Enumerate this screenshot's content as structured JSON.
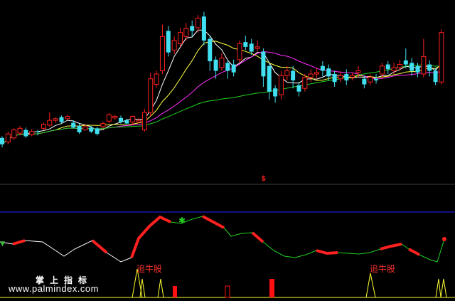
{
  "chart_data": {
    "type": "candlestick",
    "candles": [
      {
        "o": 178,
        "c": 170,
        "h": 180,
        "l": 166
      },
      {
        "o": 173,
        "c": 183,
        "h": 186,
        "l": 170
      },
      {
        "o": 178,
        "c": 188,
        "h": 190,
        "l": 176
      },
      {
        "o": 184,
        "c": 190,
        "h": 193,
        "l": 181
      },
      {
        "o": 188,
        "c": 180,
        "h": 191,
        "l": 178
      },
      {
        "o": 182,
        "c": 186,
        "h": 189,
        "l": 180
      },
      {
        "o": 186,
        "c": 185,
        "h": 188,
        "l": 181
      },
      {
        "o": 190,
        "c": 195,
        "h": 197,
        "l": 188
      },
      {
        "o": 194,
        "c": 200,
        "h": 210,
        "l": 192
      },
      {
        "o": 200,
        "c": 202,
        "h": 204,
        "l": 197
      },
      {
        "o": 204,
        "c": 198,
        "h": 206,
        "l": 196
      },
      {
        "o": 202,
        "c": 205,
        "h": 207,
        "l": 200
      },
      {
        "o": 197,
        "c": 191,
        "h": 200,
        "l": 190
      },
      {
        "o": 193,
        "c": 185,
        "h": 196,
        "l": 183
      },
      {
        "o": 188,
        "c": 192,
        "h": 194,
        "l": 187
      },
      {
        "o": 191,
        "c": 186,
        "h": 193,
        "l": 184
      },
      {
        "o": 190,
        "c": 183,
        "h": 192,
        "l": 181
      },
      {
        "o": 192,
        "c": 196,
        "h": 198,
        "l": 190
      },
      {
        "o": 199,
        "c": 207,
        "h": 209,
        "l": 197
      },
      {
        "o": 203,
        "c": 205,
        "h": 207,
        "l": 201
      },
      {
        "o": 203,
        "c": 198,
        "h": 206,
        "l": 196
      },
      {
        "o": 200,
        "c": 196,
        "h": 202,
        "l": 195
      },
      {
        "o": 198,
        "c": 205,
        "h": 206,
        "l": 194
      },
      {
        "o": 198,
        "c": 200,
        "h": 203,
        "l": 196
      },
      {
        "o": 188,
        "c": 210,
        "h": 214,
        "l": 186
      },
      {
        "o": 210,
        "c": 252,
        "h": 260,
        "l": 205
      },
      {
        "o": 245,
        "c": 258,
        "h": 262,
        "l": 241
      },
      {
        "o": 262,
        "c": 305,
        "h": 320,
        "l": 258
      },
      {
        "o": 312,
        "c": 285,
        "h": 318,
        "l": 280
      },
      {
        "o": 288,
        "c": 300,
        "h": 305,
        "l": 283
      },
      {
        "o": 296,
        "c": 310,
        "h": 316,
        "l": 292
      },
      {
        "o": 305,
        "c": 315,
        "h": 322,
        "l": 300
      },
      {
        "o": 318,
        "c": 312,
        "h": 325,
        "l": 305
      },
      {
        "o": 316,
        "c": 328,
        "h": 332,
        "l": 310
      },
      {
        "o": 330,
        "c": 300,
        "h": 336,
        "l": 294
      },
      {
        "o": 302,
        "c": 274,
        "h": 306,
        "l": 262
      },
      {
        "o": 276,
        "c": 262,
        "h": 280,
        "l": 252
      },
      {
        "o": 266,
        "c": 278,
        "h": 284,
        "l": 262
      },
      {
        "o": 272,
        "c": 262,
        "h": 276,
        "l": 252
      },
      {
        "o": 270,
        "c": 260,
        "h": 276,
        "l": 255
      },
      {
        "o": 276,
        "c": 296,
        "h": 300,
        "l": 272
      },
      {
        "o": 298,
        "c": 292,
        "h": 306,
        "l": 288
      },
      {
        "o": 296,
        "c": 286,
        "h": 302,
        "l": 282
      },
      {
        "o": 290,
        "c": 292,
        "h": 300,
        "l": 286
      },
      {
        "o": 286,
        "c": 255,
        "h": 290,
        "l": 242
      },
      {
        "o": 268,
        "c": 236,
        "h": 272,
        "l": 226
      },
      {
        "o": 240,
        "c": 230,
        "h": 244,
        "l": 222
      },
      {
        "o": 232,
        "c": 256,
        "h": 262,
        "l": 226
      },
      {
        "o": 256,
        "c": 262,
        "h": 268,
        "l": 250
      },
      {
        "o": 262,
        "c": 250,
        "h": 268,
        "l": 240
      },
      {
        "o": 244,
        "c": 236,
        "h": 248,
        "l": 230
      },
      {
        "o": 240,
        "c": 254,
        "h": 258,
        "l": 236
      },
      {
        "o": 254,
        "c": 258,
        "h": 264,
        "l": 248
      },
      {
        "o": 258,
        "c": 260,
        "h": 266,
        "l": 252
      },
      {
        "o": 268,
        "c": 262,
        "h": 274,
        "l": 255
      },
      {
        "o": 265,
        "c": 255,
        "h": 270,
        "l": 250
      },
      {
        "o": 258,
        "c": 248,
        "h": 262,
        "l": 242
      },
      {
        "o": 252,
        "c": 256,
        "h": 262,
        "l": 248
      },
      {
        "o": 258,
        "c": 250,
        "h": 264,
        "l": 244
      },
      {
        "o": 254,
        "c": 256,
        "h": 260,
        "l": 250
      },
      {
        "o": 260,
        "c": 262,
        "h": 268,
        "l": 254
      },
      {
        "o": 252,
        "c": 245,
        "h": 256,
        "l": 240
      },
      {
        "o": 248,
        "c": 254,
        "h": 258,
        "l": 244
      },
      {
        "o": 252,
        "c": 250,
        "h": 258,
        "l": 246
      },
      {
        "o": 258,
        "c": 268,
        "h": 272,
        "l": 252
      },
      {
        "o": 270,
        "c": 264,
        "h": 274,
        "l": 258
      },
      {
        "o": 262,
        "c": 266,
        "h": 272,
        "l": 258
      },
      {
        "o": 266,
        "c": 270,
        "h": 276,
        "l": 262
      },
      {
        "o": 275,
        "c": 270,
        "h": 290,
        "l": 265
      },
      {
        "o": 272,
        "c": 262,
        "h": 278,
        "l": 256
      },
      {
        "o": 268,
        "c": 260,
        "h": 272,
        "l": 254
      },
      {
        "o": 258,
        "c": 280,
        "h": 302,
        "l": 254
      },
      {
        "o": 270,
        "c": 262,
        "h": 275,
        "l": 255
      },
      {
        "o": 262,
        "c": 248,
        "h": 266,
        "l": 244
      },
      {
        "o": 248,
        "c": 310,
        "h": 314,
        "l": 245
      }
    ],
    "ma_lines": [
      {
        "name": "MA-white",
        "color": "#ffffff"
      },
      {
        "name": "MA-yellow",
        "color": "#ffff40"
      },
      {
        "name": "MA-magenta",
        "color": "#ff30ff"
      },
      {
        "name": "MA-green",
        "color": "#20d020"
      }
    ],
    "indicator": {
      "line_color_up": "#ff2020",
      "line_color_down_white": "#ffffff",
      "line_color_flat_green": "#20d020",
      "reference_line_color": "#2020ff",
      "histogram_color": "#ffff30"
    }
  },
  "labels": {
    "signal_1": "追牛股",
    "signal_2": "追牛股",
    "dollar_marker": "$",
    "brand_cn": "掌上指标",
    "brand_url": "www.palmindex.com"
  },
  "colors": {
    "up_candle": "#ff2020",
    "down_candle": "#40e0f0",
    "background": "#000000",
    "separator": "#404040"
  }
}
